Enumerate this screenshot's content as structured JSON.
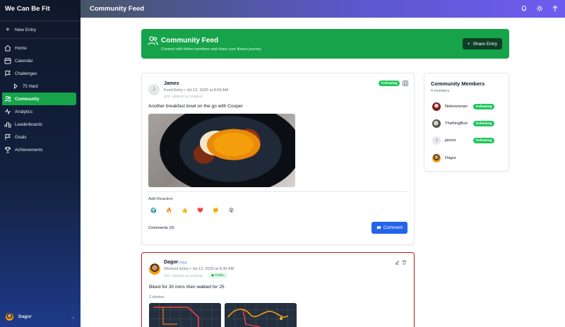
{
  "app": {
    "brand": "We Can Be Fit"
  },
  "sidebar": {
    "new_entry": "New Entry",
    "items": [
      {
        "label": "Home",
        "icon": "home-icon"
      },
      {
        "label": "Calendar",
        "icon": "calendar-icon"
      },
      {
        "label": "Challenges",
        "icon": "challenges-icon"
      },
      {
        "label": "75 Hard",
        "icon": "chevron-right-icon",
        "sub": true
      },
      {
        "label": "Community",
        "icon": "users-icon",
        "active": true
      },
      {
        "label": "Analytics",
        "icon": "analytics-icon"
      },
      {
        "label": "Leaderboards",
        "icon": "leaderboard-icon"
      },
      {
        "label": "Goals",
        "icon": "goals-icon"
      },
      {
        "label": "Achievements",
        "icon": "trophy-icon"
      }
    ],
    "user": {
      "name": "Dagor"
    }
  },
  "topbar": {
    "title": "Community Feed"
  },
  "banner": {
    "title": "Community Feed",
    "subtitle": "Connect with fellow members and share your fitness journey",
    "share_label": "Share Entry"
  },
  "posts": [
    {
      "author": "James",
      "initial": "J",
      "meta": "Food Entry • Jul 12, 2025 at 8:59 AM",
      "utc": "UTC: 2025-07-12 13:59:41",
      "follow": "Following",
      "text": "Another breakfast bowl on the go with Cooper",
      "add_reaction": "Add Reaction",
      "reactions": [
        "🌍",
        "🔥",
        "👍",
        "❤️",
        "✊",
        "😲"
      ],
      "comments": "Comments (0)",
      "comment_btn": "Comment"
    },
    {
      "author": "Dagor",
      "you": "(You)",
      "meta": "Workout Entry • Jul 12, 2025 at 8:30 AM",
      "utc": "UTC: 2025-07-12 13:30:38",
      "visibility": "Public",
      "text": "Biked for 30 mins then walked for 25",
      "photos": "2 photos"
    }
  ],
  "members": {
    "title": "Community Members",
    "count": "4 members",
    "list": [
      {
        "name": "Nekowoman",
        "follow": "Following",
        "initial": ""
      },
      {
        "name": "TheKingBun",
        "follow": "Following",
        "initial": ""
      },
      {
        "name": "james",
        "follow": "Following",
        "initial": "J"
      },
      {
        "name": "Dagor",
        "follow": "",
        "initial": ""
      }
    ]
  },
  "colors": {
    "accent_green": "#16a34a",
    "primary_blue": "#2563eb",
    "alert_red": "#b91c1c"
  }
}
